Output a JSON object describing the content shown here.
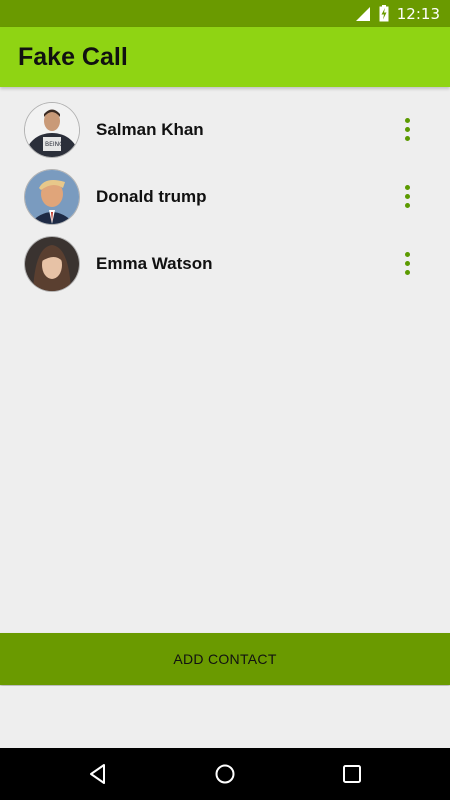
{
  "status_bar": {
    "time": "12:13",
    "icons": [
      "signal-icon",
      "battery-charging-icon"
    ]
  },
  "app_bar": {
    "title": "Fake Call"
  },
  "contacts": [
    {
      "name": "Salman Khan"
    },
    {
      "name": "Donald trump"
    },
    {
      "name": "Emma Watson"
    }
  ],
  "actions": {
    "add_contact": "ADD CONTACT"
  },
  "nav": {
    "icons": [
      "back-icon",
      "home-icon",
      "recents-icon"
    ]
  },
  "colors": {
    "status_bar": "#6a9a00",
    "app_bar": "#8fd413",
    "accent": "#5b9a00",
    "button": "#6a9a00",
    "background": "#eeeeee"
  }
}
